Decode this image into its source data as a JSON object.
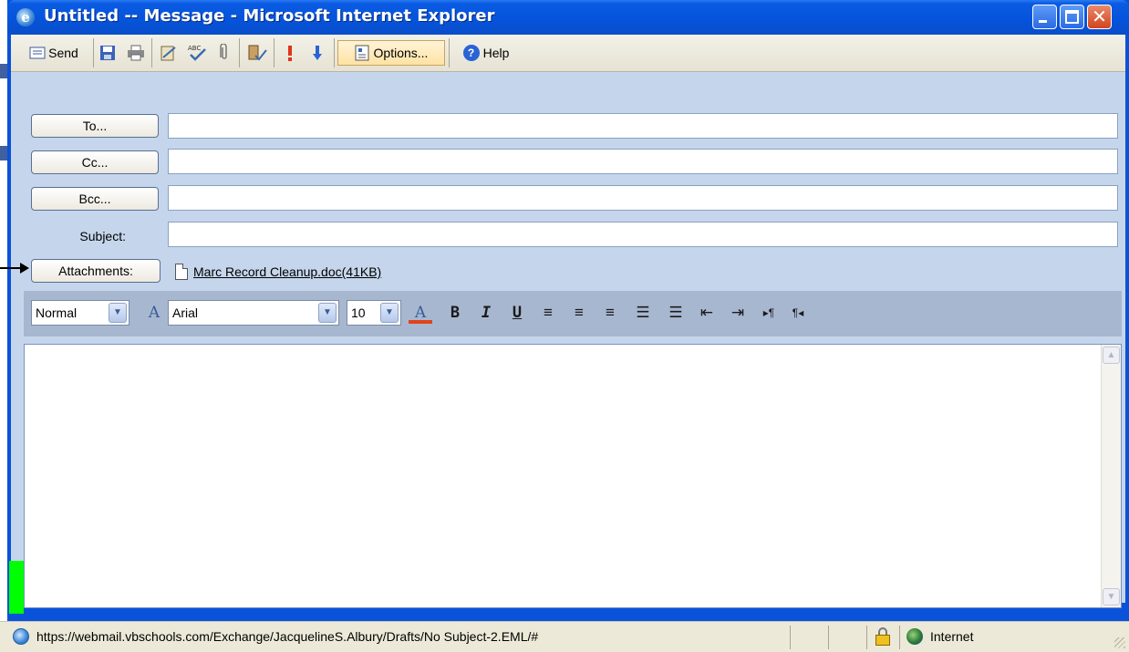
{
  "window": {
    "title": "Untitled -- Message - Microsoft Internet Explorer",
    "app_icon": "ie-icon",
    "buttons": [
      "minimize-icon",
      "maximize-icon",
      "close-icon"
    ]
  },
  "toolbar": {
    "send_label": "Send",
    "options_label": "Options...",
    "help_label": "Help"
  },
  "form": {
    "to_button": "To...",
    "cc_button": "Cc...",
    "bcc_button": "Bcc...",
    "subject_label": "Subject:",
    "attachments_button": "Attachments:",
    "attachment_file": "Marc Record Cleanup.doc(41KB)",
    "to_value": "",
    "cc_value": "",
    "bcc_value": "",
    "subject_value": ""
  },
  "format": {
    "style": "Normal",
    "font": "Arial",
    "size": "10",
    "font_color_glyph": "A",
    "bold": "B",
    "italic": "I",
    "underline": "U"
  },
  "status": {
    "url": "https://webmail.vbschools.com/Exchange/JacquelineS.Albury/Drafts/No Subject-2.EML/#",
    "zone": "Internet"
  },
  "colors": {
    "titlebar": "#0a52d9",
    "client": "#c5d6ec",
    "format_bar": "#a7b7d0",
    "green_marker": "#00ff00"
  }
}
